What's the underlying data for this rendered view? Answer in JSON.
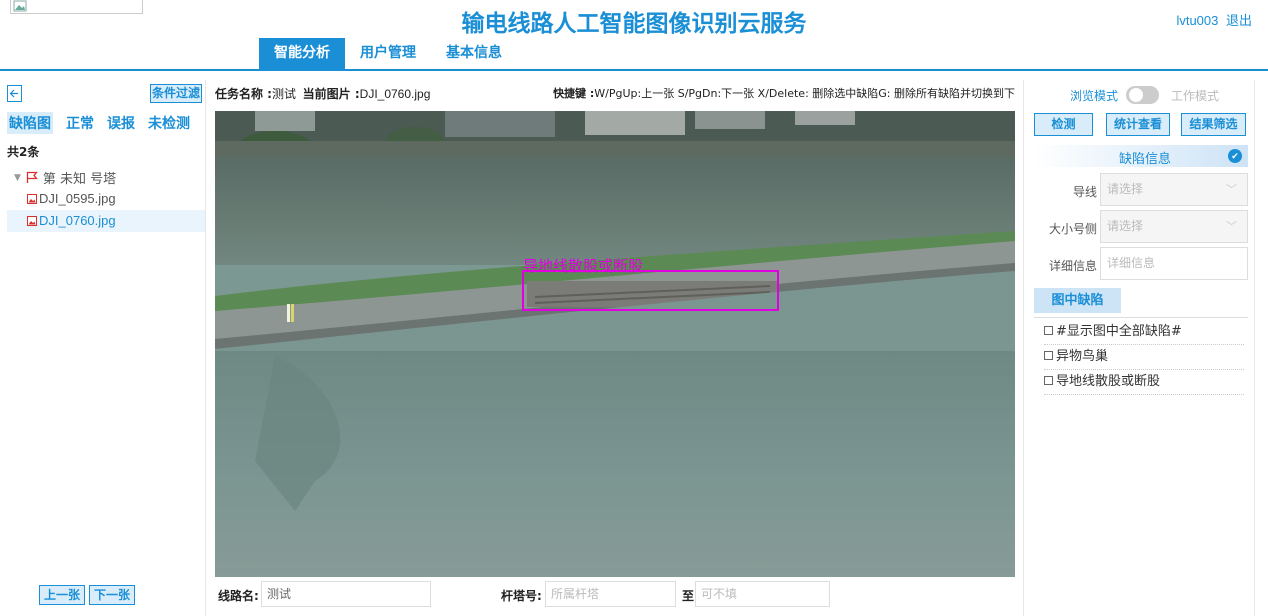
{
  "header": {
    "app_title": "输电线路人工智能图像识别云服务",
    "username": "lvtu003",
    "logout_label": "退出"
  },
  "nav": {
    "tabs": [
      {
        "label": "智能分析",
        "active": true
      },
      {
        "label": "用户管理",
        "active": false
      },
      {
        "label": "基本信息",
        "active": false
      }
    ]
  },
  "left": {
    "back_icon": "arrow-left-icon",
    "filter_label": "条件过滤",
    "sub_tabs": [
      {
        "label": "缺陷图",
        "active": true
      },
      {
        "label": "正常",
        "active": false
      },
      {
        "label": "误报",
        "active": false
      },
      {
        "label": "未检测",
        "active": false
      }
    ],
    "count_label": "共2条",
    "group_label": "第 未知 号塔",
    "files": [
      {
        "name": "DJI_0595.jpg",
        "selected": false
      },
      {
        "name": "DJI_0760.jpg",
        "selected": true
      }
    ],
    "prev_label": "上一张",
    "next_label": "下一张"
  },
  "center": {
    "task_label": "任务名称 :",
    "task_value": "测试",
    "current_label": "当前图片 :",
    "current_value": "DJI_0760.jpg",
    "hotkey_label": "快捷键 :",
    "hotkey_text": "W/PgUp:上一张 S/PgDn:下一张 X/Delete: 删除选中缺陷G: 删除所有缺陷并切换到下",
    "annotation_label": "导地线散股或断股",
    "annotation_color": "#e000e0",
    "line_name_label": "线路名:",
    "line_name_value": "测试",
    "tower_label": "杆塔号:",
    "tower_placeholder": "所属杆塔",
    "to_label": "至",
    "to_placeholder": "可不填"
  },
  "right": {
    "mode_left": "浏览模式",
    "mode_right": "工作模式",
    "buttons": [
      "检测",
      "统计查看",
      "结果筛选"
    ],
    "defect_info_title": "缺陷信息",
    "fields": [
      {
        "label": "导线",
        "placeholder": "请选择"
      },
      {
        "label": "大小号侧",
        "placeholder": "请选择"
      },
      {
        "label": "详细信息",
        "placeholder": "详细信息"
      }
    ],
    "image_defects_title": "图中缺陷",
    "defects": [
      "#显示图中全部缺陷#",
      "异物鸟巢",
      "导地线散股或断股"
    ]
  },
  "colors": {
    "accent": "#1a8fd6",
    "accent_light": "#d8ecfa"
  }
}
